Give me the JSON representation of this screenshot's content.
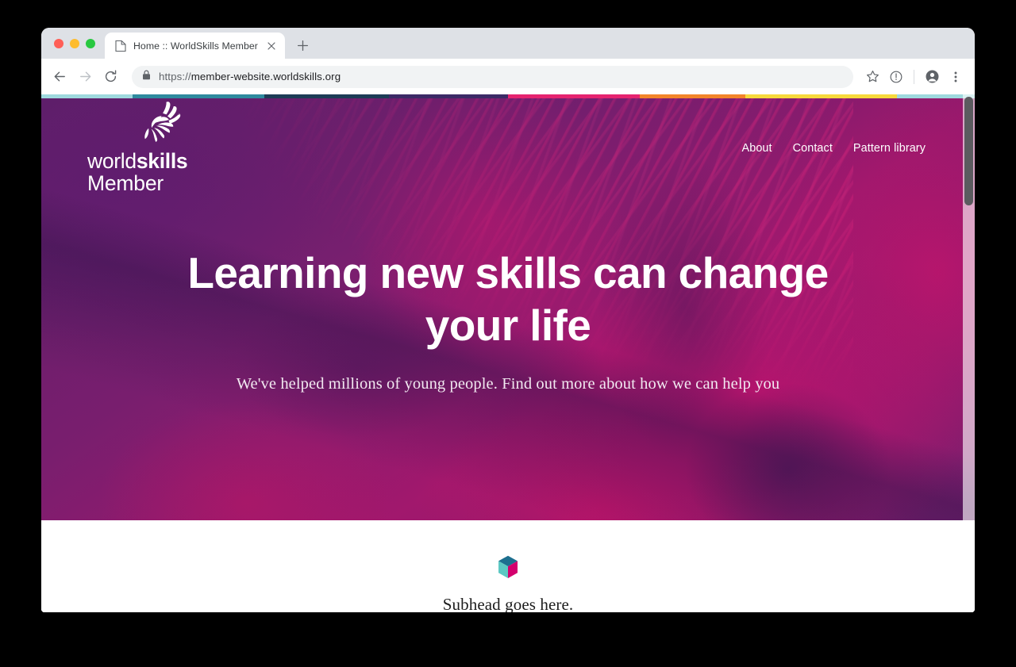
{
  "browser": {
    "traffic_lights": [
      "close",
      "minimize",
      "maximize"
    ],
    "tab": {
      "title": "Home :: WorldSkills Member",
      "favicon": "page-icon",
      "close_label": "×"
    },
    "new_tab_label": "+",
    "toolbar": {
      "back_label": "←",
      "forward_label": "→",
      "reload_label": "⟳",
      "url_scheme": "https://",
      "url_host": "member-website.worldskills.org",
      "url_full": "https://member-website.worldskills.org",
      "lock_icon": "lock-icon",
      "bookmark_icon": "star-icon",
      "info_icon": "info-circle-icon",
      "profile_icon": "profile-avatar-icon",
      "menu_icon": "three-dot-menu-icon"
    }
  },
  "site": {
    "accent_strip": [
      {
        "color": "#9fd9de",
        "width": 11.8
      },
      {
        "color": "#2e8a9e",
        "width": 16.9
      },
      {
        "color": "#1d3c56",
        "width": 16.1
      },
      {
        "color": "#3c2a66",
        "width": 15.3
      },
      {
        "color": "#e5246f",
        "width": 17.0
      },
      {
        "color": "#f3852a",
        "width": 13.6
      },
      {
        "color": "#f7d93c",
        "width": 19.5
      },
      {
        "color": "#9fd9de",
        "width": 10.0
      }
    ],
    "logo": {
      "mark": "worldskills-hand-logo-mark",
      "word_light": "world",
      "word_bold": "skills",
      "subtitle": "Member"
    },
    "nav": [
      {
        "label": "About",
        "name": "nav-link-about"
      },
      {
        "label": "Contact",
        "name": "nav-link-contact"
      },
      {
        "label": "Pattern library",
        "name": "nav-link-pattern-library"
      }
    ],
    "hero": {
      "heading": "Learning new skills can change your life",
      "subheading": "We've helped millions of young people. Find out more about how we can help you",
      "overlay_purple": "#5e1f68",
      "overlay_magenta": "#c8156c"
    },
    "feature": {
      "icon": "isometric-cube-icon",
      "cube_top_color": "#1d6f8f",
      "cube_left_color": "#5cc8c3",
      "cube_right_color": "#d4006e",
      "subhead": "Subhead goes here."
    }
  }
}
